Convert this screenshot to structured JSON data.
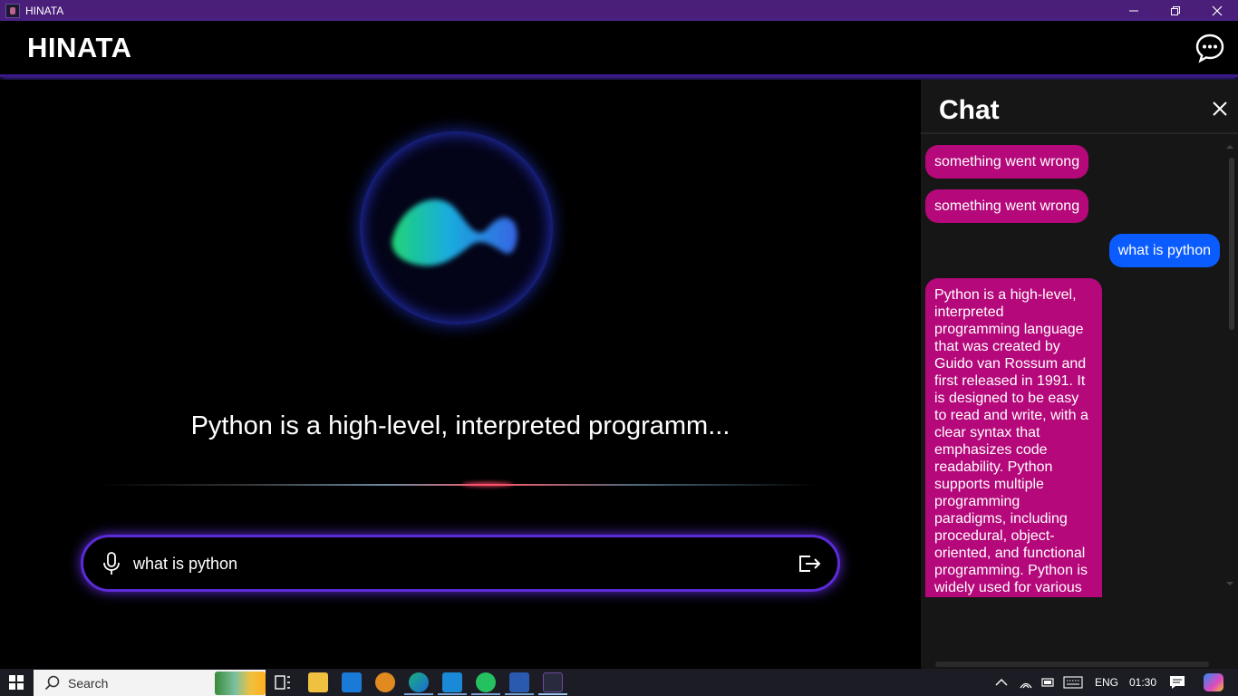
{
  "window": {
    "title": "HINATA",
    "controls": [
      "minimize",
      "restore",
      "close"
    ]
  },
  "header": {
    "brand": "HINATA",
    "chat_toggle_icon": "chat-bubble-icon"
  },
  "main": {
    "response_text": "Python is a high-level, interpreted programm...",
    "input_value": "what is python",
    "mic_icon": "microphone-icon",
    "send_icon": "exit-arrow-icon"
  },
  "chat": {
    "title": "Chat",
    "messages": [
      {
        "role": "bot",
        "text": "something went wrong"
      },
      {
        "role": "bot",
        "text": "something went wrong"
      },
      {
        "role": "user",
        "text": "what is python"
      },
      {
        "role": "bot",
        "text": "Python is a high-level, interpreted programming language that was created by Guido van Rossum and first released in 1991. It is designed to be easy to read and write, with a clear syntax that emphasizes code readability. Python supports multiple programming paradigms, including procedural, object-oriented, and functional programming. Python is widely used for various"
      }
    ]
  },
  "taskbar": {
    "search_label": "Search",
    "language": "ENG",
    "time": "01:30"
  },
  "colors": {
    "title_bar": "#4a1f7a",
    "bot_bubble": "#b5087a",
    "user_bubble": "#0b5cff",
    "input_glow": "#5b2bd6"
  }
}
